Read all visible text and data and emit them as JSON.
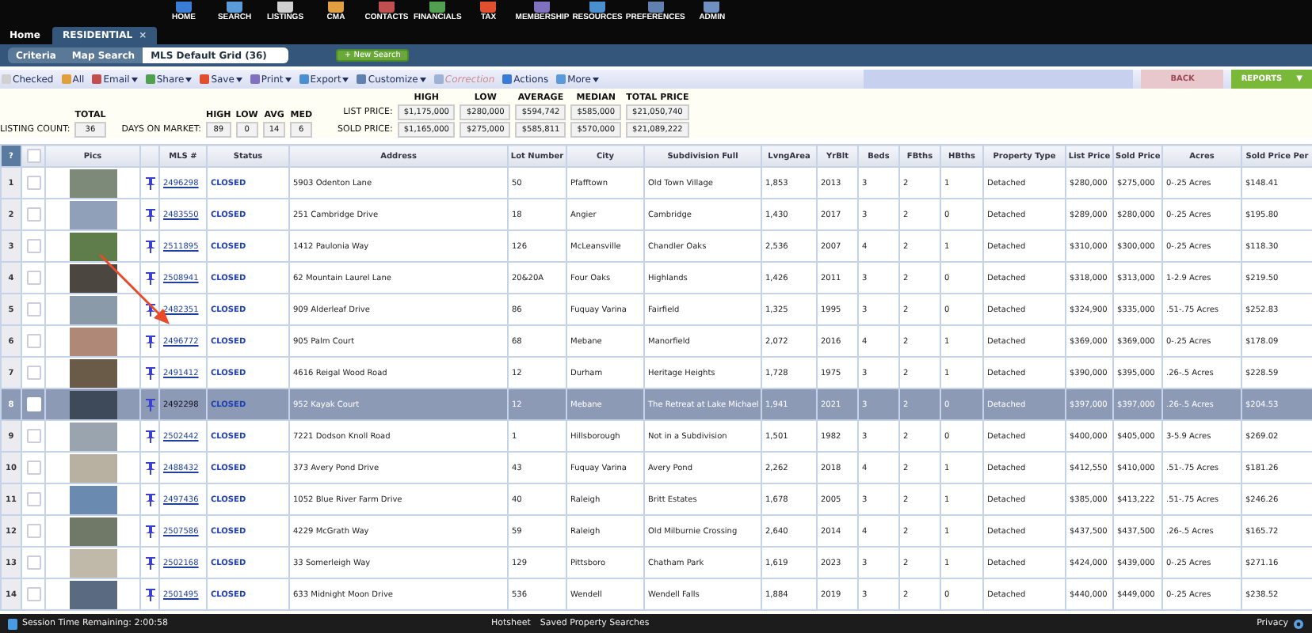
{
  "nav": [
    {
      "label": "HOME"
    },
    {
      "label": "SEARCH"
    },
    {
      "label": "LISTINGS"
    },
    {
      "label": "CMA"
    },
    {
      "label": "CONTACTS"
    },
    {
      "label": "FINANCIALS"
    },
    {
      "label": "TAX"
    },
    {
      "label": "MEMBERSHIP"
    },
    {
      "label": "RESOURCES"
    },
    {
      "label": "PREFERENCES"
    },
    {
      "label": "ADMIN"
    }
  ],
  "tabs": [
    {
      "label": "Home",
      "selected": false,
      "closable": false
    },
    {
      "label": "RESIDENTIAL",
      "selected": true,
      "closable": true,
      "close": "×"
    }
  ],
  "search_tabs": [
    {
      "label": "Criteria",
      "selected": false
    },
    {
      "label": "Map Search",
      "selected": false
    },
    {
      "label": "MLS Default Grid (36)",
      "selected": true
    }
  ],
  "new_search": "+ New Search",
  "toolbar": [
    {
      "label": "Checked",
      "menu": false,
      "disabled": false
    },
    {
      "label": "All",
      "menu": false,
      "disabled": false
    },
    {
      "label": "Email",
      "menu": true,
      "disabled": false
    },
    {
      "label": "Share",
      "menu": true,
      "disabled": false
    },
    {
      "label": "Save",
      "menu": true,
      "disabled": false
    },
    {
      "label": "Print",
      "menu": true,
      "disabled": false
    },
    {
      "label": "Export",
      "menu": true,
      "disabled": false
    },
    {
      "label": "Customize",
      "menu": true,
      "disabled": false
    },
    {
      "label": "Correction",
      "menu": false,
      "disabled": true
    },
    {
      "label": "Actions",
      "menu": false,
      "disabled": false
    },
    {
      "label": "More",
      "menu": true,
      "disabled": false
    }
  ],
  "back_button": {
    "label": "BACK",
    "disabled": true
  },
  "reports_button": {
    "label": "REPORTS",
    "caret": "▼"
  },
  "summary": {
    "count": {
      "header": "TOTAL",
      "label": "LISTING COUNT:",
      "value": "36"
    },
    "days": {
      "label": "DAYS ON MARKET:",
      "headers": [
        "HIGH",
        "LOW",
        "AVG",
        "MED"
      ],
      "values": [
        "89",
        "0",
        "14",
        "6"
      ]
    },
    "prices": {
      "headers": [
        "HIGH",
        "LOW",
        "AVERAGE",
        "MEDIAN",
        "TOTAL PRICE"
      ],
      "rows": [
        {
          "label": "LIST PRICE:",
          "values": [
            "$1,175,000",
            "$280,000",
            "$594,742",
            "$585,000",
            "$21,050,740"
          ]
        },
        {
          "label": "SOLD PRICE:",
          "values": [
            "$1,165,000",
            "$275,000",
            "$585,811",
            "$570,000",
            "$21,089,222"
          ]
        }
      ]
    }
  },
  "table": {
    "all_checked": false,
    "corner": "?",
    "pics_header": "Pics",
    "columns": [
      "MLS #",
      "Status",
      "Address",
      "Lot Number",
      "City",
      "Subdivision Full",
      "LvngArea",
      "YrBlt",
      "Beds",
      "FBths",
      "HBths",
      "Property Type",
      "List Price",
      "Sold Price",
      "Acres",
      "Sold Price Per"
    ],
    "rows": [
      {
        "number": "1",
        "selected": false,
        "checked": false,
        "cells": [
          "2496298",
          "CLOSED",
          "5903 Odenton Lane",
          "50",
          "Pfafftown",
          "Old Town Village",
          "1,853",
          "2013",
          "3",
          "2",
          "1",
          "Detached",
          "$280,000",
          "$275,000",
          "0-.25 Acres",
          "$148.41"
        ]
      },
      {
        "number": "2",
        "selected": false,
        "checked": false,
        "cells": [
          "2483550",
          "CLOSED",
          "251 Cambridge Drive",
          "18",
          "Angier",
          "Cambridge",
          "1,430",
          "2017",
          "3",
          "2",
          "0",
          "Detached",
          "$289,000",
          "$280,000",
          "0-.25 Acres",
          "$195.80"
        ]
      },
      {
        "number": "3",
        "selected": false,
        "checked": false,
        "cells": [
          "2511895",
          "CLOSED",
          "1412 Paulonia Way",
          "126",
          "McLeansville",
          "Chandler Oaks",
          "2,536",
          "2007",
          "4",
          "2",
          "1",
          "Detached",
          "$310,000",
          "$300,000",
          "0-.25 Acres",
          "$118.30"
        ]
      },
      {
        "number": "4",
        "selected": false,
        "checked": false,
        "cells": [
          "2508941",
          "CLOSED",
          "62 Mountain Laurel Lane",
          "20&20A",
          "Four Oaks",
          "Highlands",
          "1,426",
          "2011",
          "3",
          "2",
          "0",
          "Detached",
          "$318,000",
          "$313,000",
          "1-2.9 Acres",
          "$219.50"
        ]
      },
      {
        "number": "5",
        "selected": false,
        "checked": false,
        "cells": [
          "2482351",
          "CLOSED",
          "909 Alderleaf Drive",
          "86",
          "Fuquay Varina",
          "Fairfield",
          "1,325",
          "1995",
          "3",
          "2",
          "0",
          "Detached",
          "$324,900",
          "$335,000",
          ".51-.75 Acres",
          "$252.83"
        ]
      },
      {
        "number": "6",
        "selected": false,
        "checked": false,
        "cells": [
          "2496772",
          "CLOSED",
          "905 Palm Court",
          "68",
          "Mebane",
          "Manorfield",
          "2,072",
          "2016",
          "4",
          "2",
          "1",
          "Detached",
          "$369,000",
          "$369,000",
          "0-.25 Acres",
          "$178.09"
        ]
      },
      {
        "number": "7",
        "selected": false,
        "checked": false,
        "cells": [
          "2491412",
          "CLOSED",
          "4616 Reigal Wood Road",
          "12",
          "Durham",
          "Heritage Heights",
          "1,728",
          "1975",
          "3",
          "2",
          "1",
          "Detached",
          "$390,000",
          "$395,000",
          ".26-.5 Acres",
          "$228.59"
        ]
      },
      {
        "number": "8",
        "selected": true,
        "checked": false,
        "cells": [
          "2492298",
          "CLOSED",
          "952 Kayak Court",
          "12",
          "Mebane",
          "The Retreat at Lake Michael",
          "1,941",
          "2021",
          "3",
          "2",
          "0",
          "Detached",
          "$397,000",
          "$397,000",
          ".26-.5 Acres",
          "$204.53"
        ]
      },
      {
        "number": "9",
        "selected": false,
        "checked": false,
        "cells": [
          "2502442",
          "CLOSED",
          "7221 Dodson Knoll Road",
          "1",
          "Hillsborough",
          "Not in a Subdivision",
          "1,501",
          "1982",
          "3",
          "2",
          "0",
          "Detached",
          "$400,000",
          "$405,000",
          "3-5.9 Acres",
          "$269.02"
        ]
      },
      {
        "number": "10",
        "selected": false,
        "checked": false,
        "cells": [
          "2488432",
          "CLOSED",
          "373 Avery Pond Drive",
          "43",
          "Fuquay Varina",
          "Avery Pond",
          "2,262",
          "2018",
          "4",
          "2",
          "1",
          "Detached",
          "$412,550",
          "$410,000",
          ".51-.75 Acres",
          "$181.26"
        ]
      },
      {
        "number": "11",
        "selected": false,
        "checked": false,
        "cells": [
          "2497436",
          "CLOSED",
          "1052 Blue River Farm Drive",
          "40",
          "Raleigh",
          "Britt Estates",
          "1,678",
          "2005",
          "3",
          "2",
          "1",
          "Detached",
          "$385,000",
          "$413,222",
          ".51-.75 Acres",
          "$246.26"
        ]
      },
      {
        "number": "12",
        "selected": false,
        "checked": false,
        "cells": [
          "2507586",
          "CLOSED",
          "4229 McGrath Way",
          "59",
          "Raleigh",
          "Old Milburnie Crossing",
          "2,640",
          "2014",
          "4",
          "2",
          "1",
          "Detached",
          "$437,500",
          "$437,500",
          ".26-.5 Acres",
          "$165.72"
        ]
      },
      {
        "number": "13",
        "selected": false,
        "checked": false,
        "cells": [
          "2502168",
          "CLOSED",
          "33 Somerleigh Way",
          "129",
          "Pittsboro",
          "Chatham Park",
          "1,619",
          "2023",
          "3",
          "2",
          "1",
          "Detached",
          "$424,000",
          "$439,000",
          "0-.25 Acres",
          "$271.16"
        ]
      },
      {
        "number": "14",
        "selected": false,
        "checked": false,
        "cells": [
          "2501495",
          "CLOSED",
          "633 Midnight Moon Drive",
          "536",
          "Wendell",
          "Wendell Falls",
          "1,884",
          "2019",
          "3",
          "2",
          "0",
          "Detached",
          "$440,000",
          "$449,000",
          "0-.25 Acres",
          "$238.52"
        ]
      }
    ]
  },
  "footer": {
    "session": "Session Time Remaining: 2:00:58",
    "links": [
      "Hotsheet",
      "Saved Property Searches"
    ],
    "privacy": "Privacy"
  }
}
